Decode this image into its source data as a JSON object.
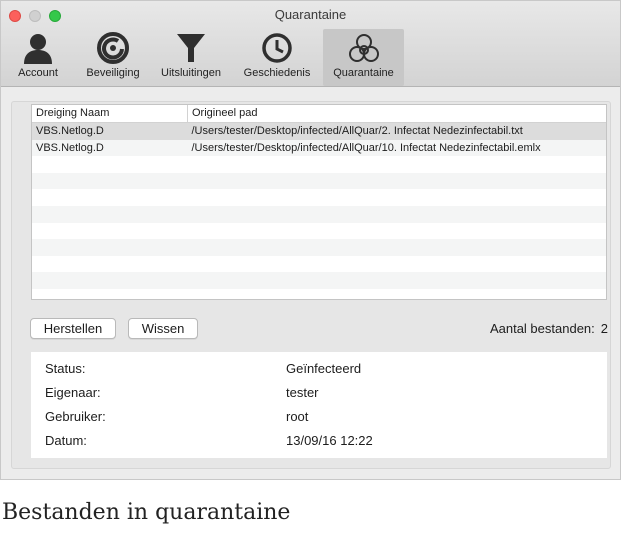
{
  "window": {
    "title": "Quarantaine"
  },
  "toolbar": {
    "items": [
      {
        "label": "Account",
        "icon": "account-icon"
      },
      {
        "label": "Beveiliging",
        "icon": "protection-icon"
      },
      {
        "label": "Uitsluitingen",
        "icon": "funnel-icon"
      },
      {
        "label": "Geschiedenis",
        "icon": "clock-icon"
      },
      {
        "label": "Quarantaine",
        "icon": "biohazard-icon",
        "active": true
      }
    ]
  },
  "table": {
    "columns": [
      "Dreiging Naam",
      "Origineel pad"
    ],
    "rows": [
      [
        "VBS.Netlog.D",
        "/Users/tester/Desktop/infected/AllQuar/2. Infectat Nedezinfectabil.txt"
      ],
      [
        "VBS.Netlog.D",
        "/Users/tester/Desktop/infected/AllQuar/10. Infectat Nedezinfectabil.emlx"
      ]
    ],
    "selected_row": 0
  },
  "actions": {
    "restore_label": "Herstellen",
    "delete_label": "Wissen"
  },
  "count": {
    "label": "Aantal bestanden:",
    "value": "2"
  },
  "details": {
    "status_label": "Status:",
    "status_value": "Geïnfecteerd",
    "owner_label": "Eigenaar:",
    "owner_value": "tester",
    "user_label": "Gebruiker:",
    "user_value": "root",
    "date_label": "Datum:",
    "date_value": "13/09/16 12:22"
  },
  "caption": "Bestanden in quarantaine",
  "colors": {
    "active_tab": "#c7c7c7",
    "selected_row": "#dcdcdc"
  }
}
